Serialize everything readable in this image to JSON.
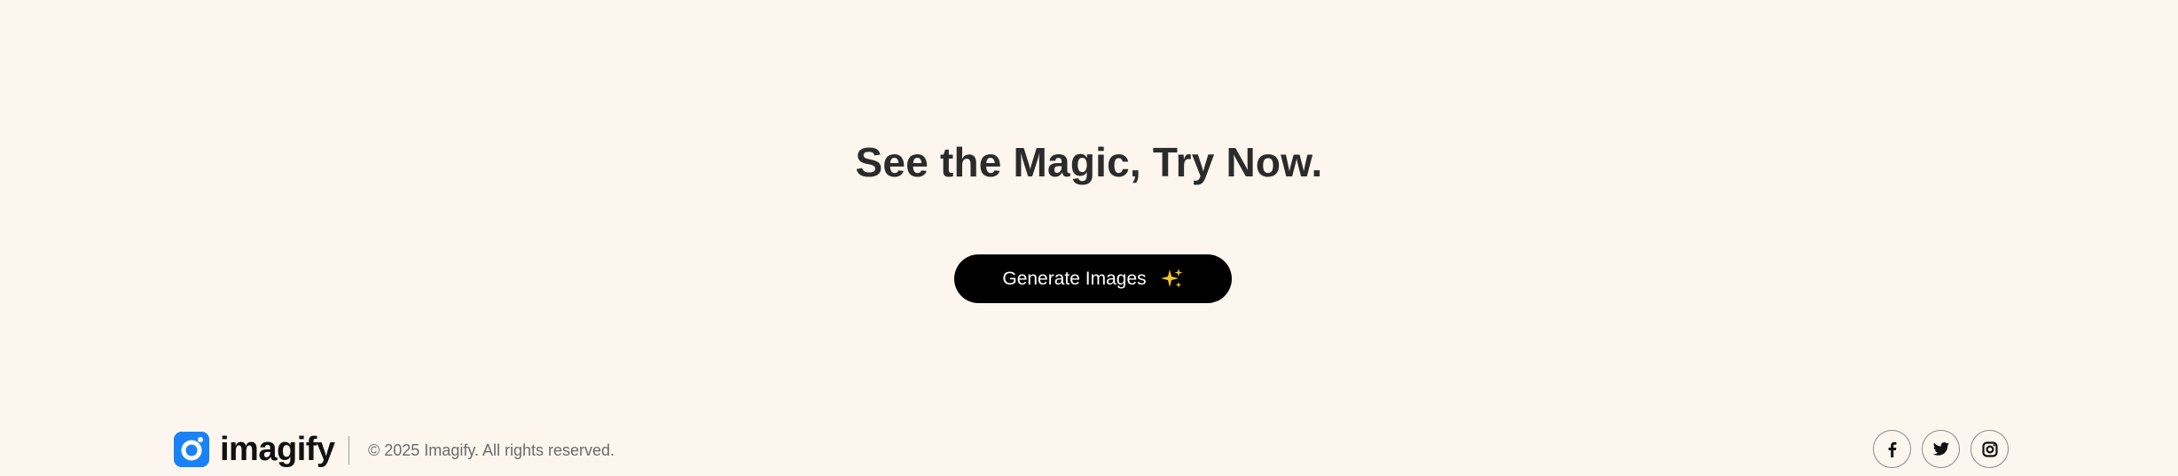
{
  "cta": {
    "headline": "See the Magic, Try Now.",
    "button_label": "Generate Images",
    "button_icon": "sparkle-icon"
  },
  "footer": {
    "logo_text": "imagify",
    "logo_icon": "camera-lens-icon",
    "brand_color": "#1a82f7",
    "copyright": "© 2025 Imagify. All rights reserved.",
    "social": [
      {
        "name": "facebook",
        "icon": "facebook-icon"
      },
      {
        "name": "twitter",
        "icon": "twitter-icon"
      },
      {
        "name": "instagram",
        "icon": "instagram-icon"
      }
    ]
  },
  "colors": {
    "background": "#fdf6ee",
    "button_bg": "#000000",
    "button_text": "#ffffff",
    "headline": "#2b2b2b"
  }
}
